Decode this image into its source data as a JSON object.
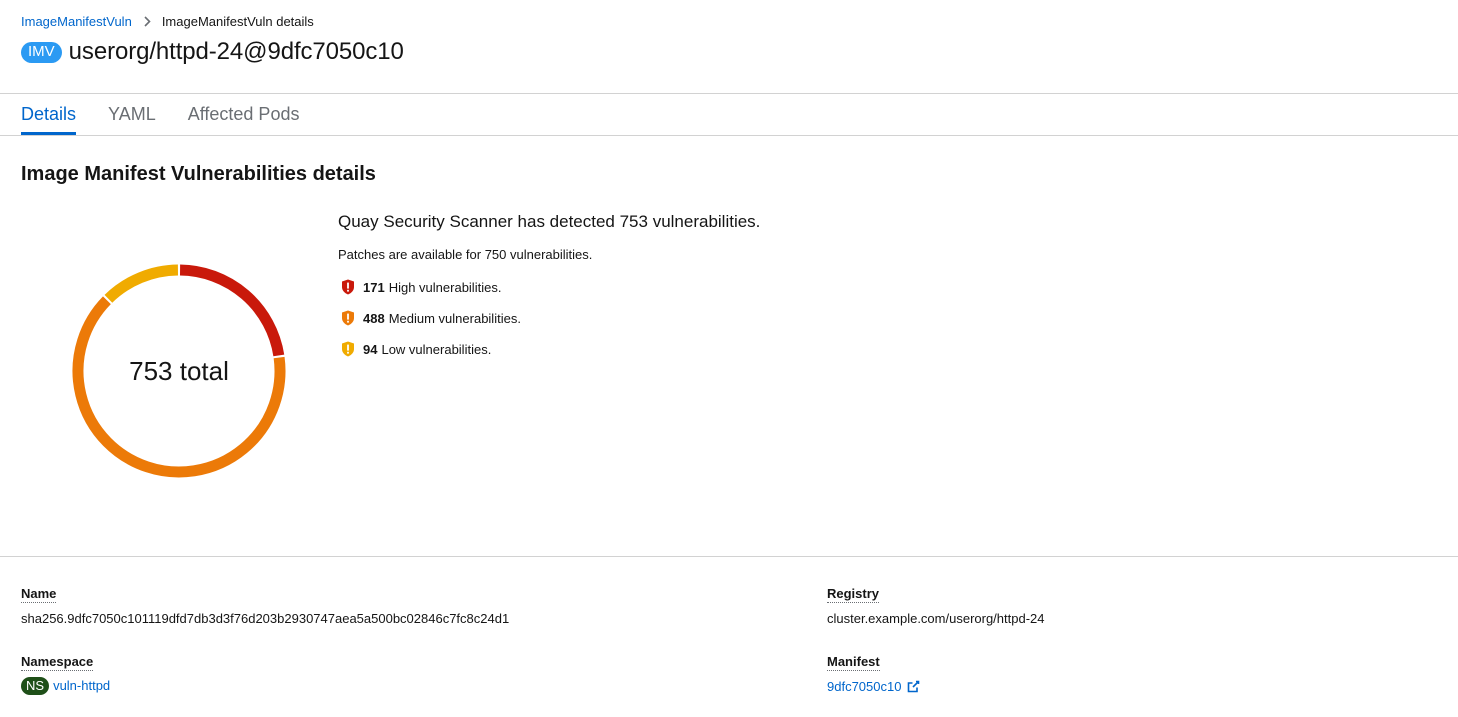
{
  "breadcrumb": {
    "parent": "ImageManifestVuln",
    "current": "ImageManifestVuln details"
  },
  "header": {
    "kind_badge": "IMV",
    "title": "userorg/httpd-24@9dfc7050c10"
  },
  "tabs": [
    {
      "label": "Details",
      "active": true
    },
    {
      "label": "YAML",
      "active": false
    },
    {
      "label": "Affected Pods",
      "active": false
    }
  ],
  "section_title": "Image Manifest Vulnerabilities details",
  "donut": {
    "center_label": "753 total",
    "total": 753,
    "segments": [
      {
        "severity": "High",
        "value": 171,
        "color": "#c9190b"
      },
      {
        "severity": "Medium",
        "value": 488,
        "color": "#ec7a08"
      },
      {
        "severity": "Low",
        "value": 94,
        "color": "#f0ab00"
      }
    ]
  },
  "summary": {
    "title": "Quay Security Scanner has detected 753 vulnerabilities.",
    "patches": "Patches are available for 750 vulnerabilities.",
    "rows": [
      {
        "count": "171",
        "text": "High vulnerabilities.",
        "color": "#c9190b",
        "icon": "shield-exclamation-icon"
      },
      {
        "count": "488",
        "text": "Medium vulnerabilities.",
        "color": "#ec7a08",
        "icon": "shield-exclamation-icon"
      },
      {
        "count": "94",
        "text": "Low vulnerabilities.",
        "color": "#f0ab00",
        "icon": "shield-exclamation-icon"
      }
    ]
  },
  "details": {
    "name_label": "Name",
    "name_value": "sha256.9dfc7050c101119dfd7db3d3f76d203b2930747aea5a500bc02846c7fc8c24d1",
    "registry_label": "Registry",
    "registry_value": "cluster.example.com/userorg/httpd-24",
    "namespace_label": "Namespace",
    "namespace_badge": "NS",
    "namespace_value": "vuln-httpd",
    "manifest_label": "Manifest",
    "manifest_value": "9dfc7050c10"
  },
  "colors": {
    "link": "#0066cc",
    "imv_badge": "#2b9af3",
    "ns_badge": "#1e4f18"
  }
}
